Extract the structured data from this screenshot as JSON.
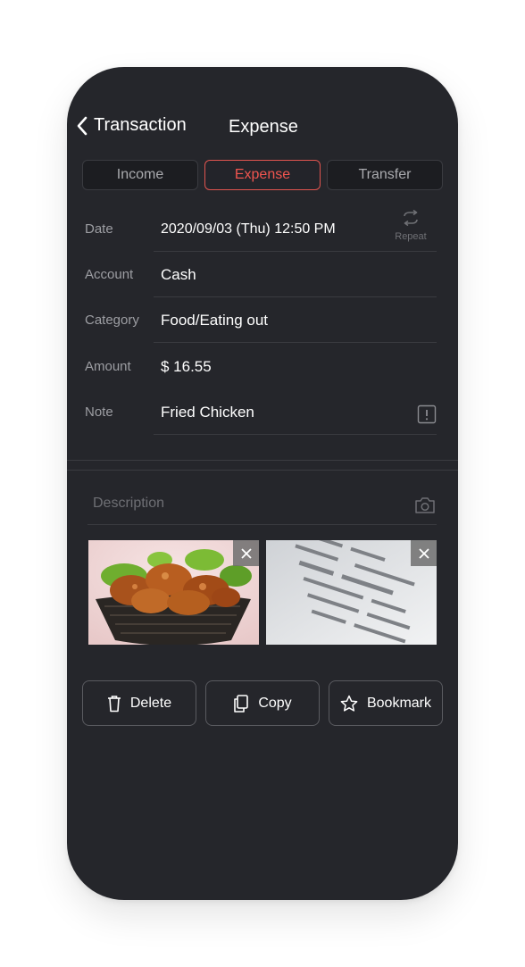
{
  "header": {
    "back_label": "Transaction",
    "title": "Expense"
  },
  "tabs": [
    {
      "label": "Income"
    },
    {
      "label": "Expense"
    },
    {
      "label": "Transfer"
    }
  ],
  "form": {
    "date_label": "Date",
    "date_value": "2020/09/03 (Thu)   12:50 PM",
    "repeat_label": "Repeat",
    "account_label": "Account",
    "account_value": "Cash",
    "category_label": "Category",
    "category_value": "Food/Eating out",
    "amount_label": "Amount",
    "amount_value": "$ 16.55",
    "note_label": "Note",
    "note_value": "Fried Chicken"
  },
  "description": {
    "placeholder": "Description"
  },
  "actions": {
    "delete_label": "Delete",
    "copy_label": "Copy",
    "bookmark_label": "Bookmark"
  },
  "colors": {
    "background": "#25262b",
    "accent": "#f0554f",
    "text": "#ffffff",
    "muted": "#9d9ea3"
  },
  "icons": [
    "chevron-left-icon",
    "repeat-icon",
    "alert-icon",
    "camera-icon",
    "close-icon",
    "trash-icon",
    "copy-icon",
    "star-icon"
  ]
}
